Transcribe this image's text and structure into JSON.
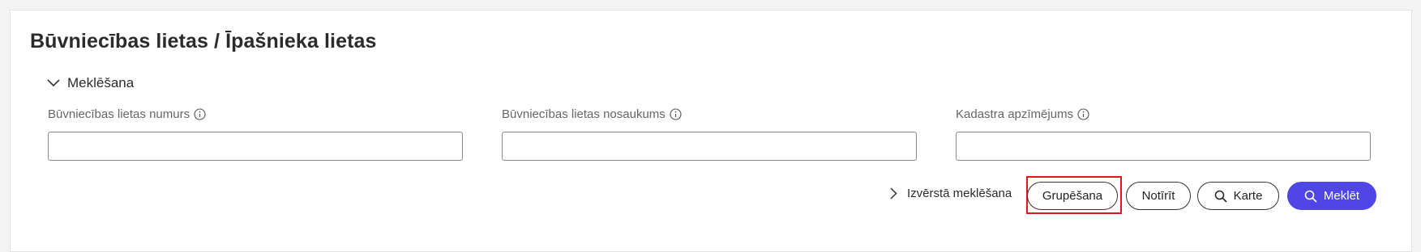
{
  "page": {
    "title": "Būvniecības lietas / Īpašnieka lietas"
  },
  "search": {
    "toggle_label": "Meklēšana",
    "fields": [
      {
        "label": "Būvniecības lietas numurs",
        "value": "",
        "placeholder": ""
      },
      {
        "label": "Būvniecības lietas nosaukums",
        "value": "",
        "placeholder": ""
      },
      {
        "label": "Kadastra apzīmējums",
        "value": "",
        "placeholder": ""
      }
    ],
    "advanced_label": "Izvērstā meklēšana"
  },
  "actions": {
    "grouping_label": "Grupēšana",
    "clear_label": "Notīrīt",
    "map_label": "Karte",
    "search_label": "Meklēt"
  },
  "colors": {
    "primary": "#4f46e5",
    "highlight": "#e01818"
  }
}
